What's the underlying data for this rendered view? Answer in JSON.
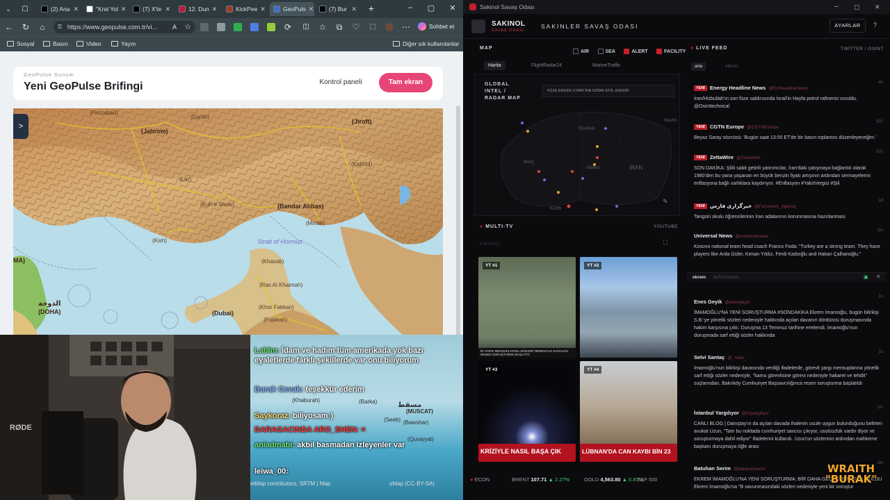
{
  "browser": {
    "tabs": [
      {
        "label": "(2) Ana",
        "color": "#000000"
      },
      {
        "label": "\"Kral Yol",
        "color": "#ffffff"
      },
      {
        "label": "(7) X'te",
        "color": "#000000"
      },
      {
        "label": "12. Dun",
        "color": "#c6173c"
      },
      {
        "label": "KickPee",
        "color": "#a43a25"
      },
      {
        "label": "GeoPuls",
        "color": "#3e6fd0"
      },
      {
        "label": "(7) Bur",
        "color": "#000000"
      }
    ],
    "url": "https://www.geopulse.com.tr/vi...",
    "copilot_label": "Sohbet et",
    "bookmarks": [
      "Sosyal",
      "Basın",
      "Video",
      "Yayın"
    ],
    "other_bookmarks": "Diğer sık kullanılanlar"
  },
  "geopulse": {
    "kicker": "GeoPulse Sunum",
    "title": "Yeni GeoPulse Brifingi",
    "btn_panel": "Kontrol paneli",
    "btn_full": "Tam ekran",
    "toggle": ">",
    "map_labels": {
      "firuzabad": "(Firuzabad)",
      "darab": "(Darab)",
      "jahrom": "(Jahrom)",
      "jiroft": "(Jiroft)",
      "lar": "(Lar)",
      "kahnuj": "(Kahnuj)",
      "bandar_abbas": "(Bandar Abbas)",
      "minab": "(Minab)",
      "kuhe_show": "(Kuh-e Show)",
      "kish": "(Kish)",
      "hormuz": "Strait of Hormuz",
      "khasab": "(Khasab)",
      "ras_al_khaimah": "(Ras Al Khaimah)",
      "khor_fakkan": "(Khor Fakkan)",
      "dubai": "(Dubai)",
      "fujairah": "(Fujairah)",
      "doha_ar": "الدوحة",
      "doha": "(DOHA)",
      "ma": "MA)",
      "muscat_ar": "مسقط",
      "muscat": "(MUSCAT)",
      "barka": "(Barka)",
      "seeb": "(Seeb)",
      "bawshar": "(Bawshar)",
      "quriyat": "(Qurayyat)",
      "khaburah": "(Khaburah)",
      "attribution": "etMap contributors, SRTM | Map",
      "attribution2": "oMap (CC-BY-SA)"
    }
  },
  "stream_chat": [
    {
      "user": "Lablm:",
      "text": "İdam ve hadım tüm amerikada yok bazı eyaletlerde farklı şekillerde var onu biliyorum"
    },
    {
      "user": "Burak Cevak:",
      "text": "teşekkür ederim"
    },
    {
      "user": "Saykoraz:",
      "text": "biliyosam:)"
    },
    {
      "user": "",
      "text": "DARAGACINDA ARO_SHEN: ="
    },
    {
      "user": "aniadmabi:",
      "text": "akbil basmadan izleyenler var"
    },
    {
      "user": "",
      "text": "leiwa_00:"
    }
  ],
  "webcam": {
    "mic_brand": "RØDE"
  },
  "dashboard": {
    "window_title": "Sakinol Savaş Odası",
    "brand": "SAKINOL",
    "brand_sub": "SAVAŞ ODASI",
    "room_title": "SAKİNLER SAVAŞ ODASI",
    "settings": "AYARLAR",
    "help": "?",
    "map_section": "MAP",
    "layers": [
      {
        "label": "AIR",
        "on": false
      },
      {
        "label": "SEA",
        "on": false
      },
      {
        "label": "ALERT",
        "on": true
      },
      {
        "label": "FACILITY",
        "on": true
      }
    ],
    "map_tabs": [
      "Harita",
      "FlightRadar24",
      "MarineTraffic"
    ],
    "radar_title": "GLOBAL INTEL / RADAR MAP",
    "radar_legend": "FÜZE  ERKEN UYARI  İHA  SIZMA  SİVİL  ASKERİ",
    "radar_labels": {
      "iran": "IRAN",
      "tehran": "TEHRAN",
      "iraq": "IRAQ",
      "isfahan": "İsfahan",
      "kuwait": "KUW",
      "mashhad": "Mashh"
    },
    "multi_tv": "MULTI-TV",
    "youtube": "YOUTUBE",
    "tv_count": "4 KANAL",
    "tiles": [
      {
        "label": "YT #1",
        "caption": "İN YARGI MENSUPLARINA SÖZLERİ NEDENİYLE SAVCILIĞI RESEN SORUŞTURMA BAŞLATTI"
      },
      {
        "label": "YT #2",
        "caption": ""
      },
      {
        "label": "YT #3",
        "caption": "KRİZİYLE NASIL BAŞA ÇIK"
      },
      {
        "label": "YT #4",
        "caption": "LÜBNAN'DA CAN KAYBI BİN 23"
      }
    ],
    "live_feed": "LIVE FEED",
    "feed_sources": "TWITTER / OSINT",
    "feed_tabs": [
      "ana",
      "ekrem"
    ],
    "feed1": [
      {
        "new": true,
        "name": "Energy Headline News",
        "handle": "@EnHeadlineNews",
        "time": "4s",
        "text": "İran/Hizbullah'ın son füze saldırısında İsrail'in Hayfa petrol rafinerisi vuruldu. @Osinttechnical"
      },
      {
        "new": true,
        "name": "CGTN Europe",
        "handle": "@CGTNEurope",
        "time": "52s",
        "text": "Beyaz Saray sözcüsü: 'Bugün saat 13:00 ET'de bir basın toplantısı düzenleyeceğim.'"
      },
      {
        "new": true,
        "name": "ZettaWire",
        "handle": "@ZettaWire",
        "time": "57s",
        "text": "SON DAKİKA: Şilili sabit getirili yatırımcılar, İran'daki çatışmaya bağlantılı olarak 1980'den bu yana yaşanan en büyük benzin fiyatı artışının ardından sermayelerini enflasyona bağlı varlıklara kaydırıyor. #Enflasyon #YakıtVergisi #Şili"
      },
      {
        "new": true,
        "name": "خبرگزاری فارس",
        "handle": "@Farsnews_Agency",
        "time": "1d",
        "text": "Tangsiri okulu öğrencilerinin İran adalarının korunmasına hazırlanması"
      },
      {
        "new": false,
        "name": "Universal News",
        "handle": "@universalnews",
        "time": "1m",
        "text": "Kosovo national team head coach Franco Foda: \"Turkey are a strong team. They have players like Arda Güler, Kenan Yıldız, Ferdi Kadıoğlu and Hakan Çalhanoğlu.\""
      }
    ],
    "feed2_title": "ekrem",
    "feed2_sub": "AUTO-POSTED",
    "feed2": [
      {
        "name": "Enes Geyik",
        "handle": "@enesgeyik",
        "time": "1s",
        "text": "İMAMOĞLU'NA YENİ SORUŞTURMA #SONDAKİKA Ekrem İmamoğlu, bugün bilirkişi S.B.'ye yönelik sözleri nedeniyle hakkında açılan davanın dördüncü duruşmasında hakim karşısına çıktı. Duruşma 13 Temmuz tarihine ertelendi. İmamoğlu'nun duruşmada sarf ettiği sözler hakkında"
      },
      {
        "name": "Selvi Santaç",
        "handle": "@_selvi_",
        "time": "1s",
        "text": "İmamoğlu'nun bilirkişi davasında verdiği ifadelerde, görevli yargı mensuplarına yönelik sarf ettiği sözler nedeniyle, \"kamu görevlisine görevi nedeniyle hakaret ve tehdit\" suçlarından, Bakırköy Cumhuriyet Başsavcılığınca resen soruşturma başlatıldı"
      },
      {
        "name": "İstanbul Yargılıyor",
        "handle": "@istyargiliyor",
        "time": "1m",
        "text": "CANLI BLOG | Danıştay'ın da açılan davada ihalenin usule uygun bulunduğunu belirten avukat Uzun, \"Tam bu noktada cumhuriyet savcısı çıkıyor, usulsüzlük vardır diyor ve soruşturmaya dahil ediyor\" ifadelerini kullandı. Uzun'un sözlerinin ardından mahkeme başkanı duruşmaya öğle arası"
      },
      {
        "name": "Batuhan Serim",
        "handle": "@batuhanserim",
        "time": "1m",
        "text": "EKREM İMAMOĞLU'NA YENİ SORUŞTURMA: BİR DAHA GEÇMEDEN DUYURULDU Ekrem İmamoğlu'na \"B savunmasındaki sözleri nedeniyle yeni bir soruştur"
      }
    ],
    "ticker": [
      {
        "label": "ECON",
        "value": "",
        "change": ""
      },
      {
        "label": "BRENT",
        "value": "107.71",
        "change": "▲ 2.27%"
      },
      {
        "label": "GOLD",
        "value": "4,563.80",
        "change": "▲ 0.87%"
      },
      {
        "label": "S&P 500",
        "value": "",
        "change": ""
      }
    ],
    "watermark": "WRAITH \"BURAK\""
  },
  "colors": {
    "accent_pink": "#e84577",
    "alert_red": "#c8202f",
    "gain_green": "#3fd07a"
  }
}
